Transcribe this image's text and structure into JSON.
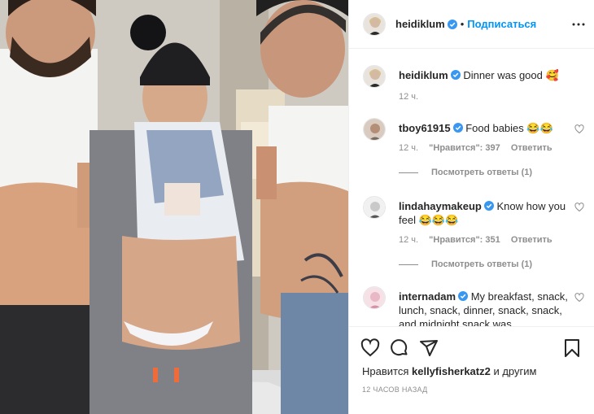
{
  "header": {
    "username": "heidiklum",
    "separator": "•",
    "follow_label": "Подписаться"
  },
  "caption": {
    "username": "heidiklum",
    "text": "Dinner was good 🥰",
    "time": "12 ч."
  },
  "comments": [
    {
      "username": "tboy61915",
      "text": "Food babies 😂😂",
      "time": "12 ч.",
      "likes": "\"Нравится\": 397",
      "reply_label": "Ответить",
      "view_replies": "Посмотреть ответы (1)"
    },
    {
      "username": "lindahaymakeup",
      "text": "Know how you feel 😂😂😂",
      "time": "12 ч.",
      "likes": "\"Нравится\": 351",
      "reply_label": "Ответить",
      "view_replies": "Посмотреть ответы (1)"
    },
    {
      "username": "internadam",
      "text": "My breakfast, snack, lunch, snack, dinner, snack, snack, and midnight snack was"
    }
  ],
  "likes_line": {
    "prefix": "Нравится",
    "user": "kellyfisherkatz2",
    "suffix": "и другим"
  },
  "timestamp": "12 ЧАСОВ НАЗАД",
  "colors": {
    "accent": "#0095f6",
    "verified": "#3897f0",
    "muted": "#8e8e8e",
    "text": "#262626"
  },
  "icons": [
    "more-options-icon",
    "verified-badge-icon",
    "like-icon",
    "comment-icon",
    "share-icon",
    "save-icon"
  ]
}
